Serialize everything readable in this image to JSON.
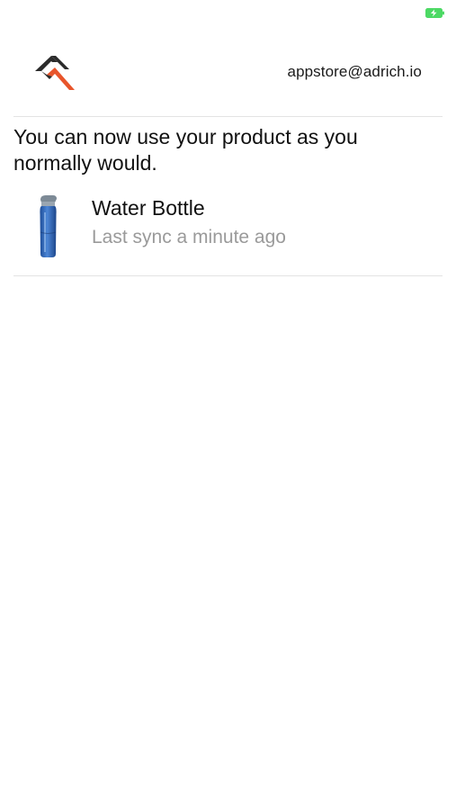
{
  "status_bar": {
    "battery_icon": "battery-charging-icon",
    "battery_color": "#4cd964"
  },
  "header": {
    "logo_icon": "adrich-logo-icon",
    "account_email": "appstore@adrich.io"
  },
  "main": {
    "message": "You can now use your product as you normally would.",
    "products": [
      {
        "image_icon": "water-bottle-image",
        "name": "Water Bottle",
        "sync_status": "Last sync a minute ago"
      }
    ]
  },
  "colors": {
    "logo_dark": "#2b2b2b",
    "logo_accent": "#e8552b",
    "secondary_text": "#9a9a9a",
    "divider": "#e3e3e3"
  }
}
